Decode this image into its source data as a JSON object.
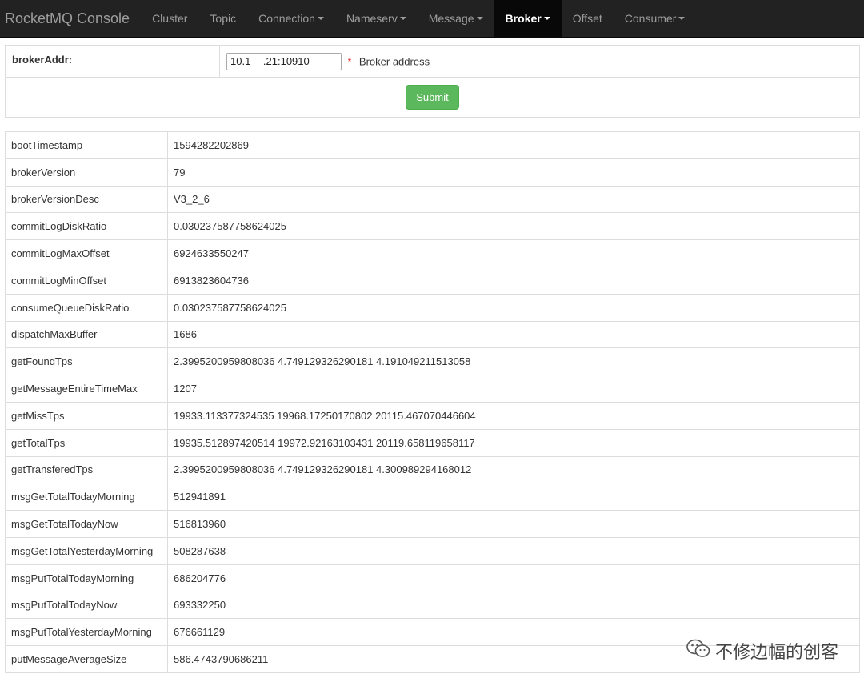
{
  "brand": "RocketMQ Console",
  "nav": [
    {
      "label": "Cluster",
      "dropdown": false,
      "active": false
    },
    {
      "label": "Topic",
      "dropdown": false,
      "active": false
    },
    {
      "label": "Connection",
      "dropdown": true,
      "active": false
    },
    {
      "label": "Nameserv",
      "dropdown": true,
      "active": false
    },
    {
      "label": "Message",
      "dropdown": true,
      "active": false
    },
    {
      "label": "Broker",
      "dropdown": true,
      "active": true
    },
    {
      "label": "Offset",
      "dropdown": false,
      "active": false
    },
    {
      "label": "Consumer",
      "dropdown": true,
      "active": false
    }
  ],
  "form": {
    "label": "brokerAddr:",
    "value": "10.1      .21:10910",
    "required_mark": "*",
    "hint": "Broker address",
    "submit_label": "Submit"
  },
  "rows": [
    {
      "key": "bootTimestamp",
      "value": "1594282202869"
    },
    {
      "key": "brokerVersion",
      "value": "79"
    },
    {
      "key": "brokerVersionDesc",
      "value": "V3_2_6"
    },
    {
      "key": "commitLogDiskRatio",
      "value": "0.030237587758624025"
    },
    {
      "key": "commitLogMaxOffset",
      "value": "6924633550247"
    },
    {
      "key": "commitLogMinOffset",
      "value": "6913823604736"
    },
    {
      "key": "consumeQueueDiskRatio",
      "value": "0.030237587758624025"
    },
    {
      "key": "dispatchMaxBuffer",
      "value": "1686"
    },
    {
      "key": "getFoundTps",
      "value": "2.3995200959808036 4.749129326290181 4.191049211513058"
    },
    {
      "key": "getMessageEntireTimeMax",
      "value": "1207"
    },
    {
      "key": "getMissTps",
      "value": "19933.113377324535 19968.17250170802 20115.467070446604"
    },
    {
      "key": "getTotalTps",
      "value": "19935.512897420514 19972.92163103431 20119.658119658117"
    },
    {
      "key": "getTransferedTps",
      "value": "2.3995200959808036 4.749129326290181 4.300989294168012"
    },
    {
      "key": "msgGetTotalTodayMorning",
      "value": "512941891"
    },
    {
      "key": "msgGetTotalTodayNow",
      "value": "516813960"
    },
    {
      "key": "msgGetTotalYesterdayMorning",
      "value": "508287638"
    },
    {
      "key": "msgPutTotalTodayMorning",
      "value": "686204776"
    },
    {
      "key": "msgPutTotalTodayNow",
      "value": "693332250"
    },
    {
      "key": "msgPutTotalYesterdayMorning",
      "value": "676661129"
    },
    {
      "key": "putMessageAverageSize",
      "value": "586.4743790686211"
    }
  ],
  "watermark": {
    "text": "不修边幅的创客",
    "icon": "wechat-icon"
  },
  "colors": {
    "navbar": "#222222",
    "submit": "#5cb85c",
    "border": "#dddddd"
  }
}
